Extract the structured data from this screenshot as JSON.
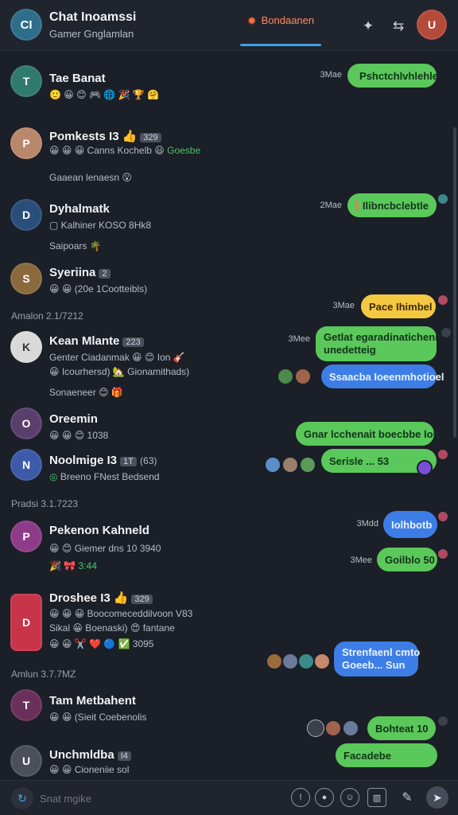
{
  "header": {
    "title": "Chat Inoamssi",
    "subtitle": "Gamer Gnglamlan",
    "tab_label": "Bondaanen",
    "avatar_initials": "CI",
    "user_initials": "U"
  },
  "composer": {
    "placeholder": "Snat mgike"
  },
  "dates": [
    "Amalon  2.1/7212",
    "Pradsi  3.1.7223",
    "Amlun  3.7.7MZ"
  ],
  "conversations": [
    {
      "name": "Tae Banat",
      "badge": "",
      "line1": "🙂 😀 😊 🎮 🌐 🎉 🏆 🤗",
      "line2": "",
      "avatar_color": "#2f7a6b"
    },
    {
      "name": "Pomkests I3",
      "badge": "329",
      "line1": "😀 😀 😀  Canns Kochelb 😃",
      "line1_green": "Goesbe",
      "line2": "Gaaean lenaesn 😮",
      "avatar_color": "#b9876a"
    },
    {
      "name": "Dyhalmatk",
      "badge": "",
      "line1": "Kalhiner KOSO 8Hk8",
      "line2": "Saipoars 🌴",
      "avatar_color": "#2a4e7a"
    },
    {
      "name": "Syeriina",
      "badge": "2",
      "line1": "😀 😀 (20e 1Cootteibls)",
      "line2": "",
      "avatar_color": "#8a6a3d"
    },
    {
      "name": "Kean Mlante",
      "badge": "223",
      "line1": "Genter Ciadanmak 😀 😊 Ion 🎸",
      "line2": "😀 Icourhersd) 🏡 Gionamithads)",
      "line3": "Sonaeneer 😊 🎁",
      "avatar_color": "#d9d9d9"
    },
    {
      "name": "Oreemin",
      "badge": "",
      "line1": "😀 😀 😊 1038",
      "line2": "",
      "avatar_color": "#5a3f6d"
    },
    {
      "name": "Noolmige I3",
      "badge": "1T",
      "line1_extra": "(63)",
      "line1": "Breeno  FNest Bedsend",
      "line2": "",
      "avatar_color": "#3c5aa8"
    },
    {
      "name": "Pekenon Kahneld",
      "badge": "",
      "line1": "😀 😊 Giemer dns 10 3940",
      "line2": "🎉 🎀 3:44",
      "avatar_color": "#8e3b8a"
    },
    {
      "name": "Droshee I3",
      "badge": "329",
      "line1": "😀 😀 😀 Boocomeceddilvoon V83",
      "line2": "Sikal 😀 Boenaski) 😍 fantane",
      "line3": "😀 😀 ✂️ ❤️ 🔵 ✅ 3095",
      "avatar_color": "#c8344a"
    },
    {
      "name": "Tam Metbahent",
      "badge": "",
      "line1": "😀 😀 (Sieit Coebenolis",
      "line2": "",
      "avatar_color": "#6a2f5a"
    },
    {
      "name": "Unchmldba",
      "badge": "I4",
      "line1": "😀 😀 Cioneniie sol",
      "line2": "",
      "avatar_color": "#4a4f5a"
    }
  ],
  "messages": [
    {
      "time": "3Mae",
      "text": "Pshctchlvhlehle",
      "color": "green"
    },
    {
      "time": "2Mae",
      "text": "Ilibncbclebtle",
      "color": "green"
    },
    {
      "time": "3Mae",
      "text": "Pace Ihimbel",
      "color": "yellow"
    },
    {
      "time": "3Mee",
      "text": "Getlat egaradinatichenit",
      "text2": "unedetteig",
      "color": "green"
    },
    {
      "time": "",
      "text": "Ssaacba Ioeenmhotioel",
      "color": "blue"
    },
    {
      "time": "",
      "text": "Gnar lcchenait boecbbe loit",
      "color": "green"
    },
    {
      "time": "",
      "text": "Serisle  ...   53",
      "color": "green"
    },
    {
      "time": "3Mdd",
      "text": "Iolhbotb",
      "color": "blue"
    },
    {
      "time": "3Mee",
      "text": "Goilblo 50",
      "color": "green"
    },
    {
      "time": "",
      "text": "Strenfaenl cmto",
      "text2": "Goeeb...   Sun",
      "color": "blue"
    },
    {
      "time": "",
      "text": "Bohteat 10",
      "color": "green"
    },
    {
      "time": "",
      "text": "Facadebe",
      "color": "green"
    }
  ]
}
